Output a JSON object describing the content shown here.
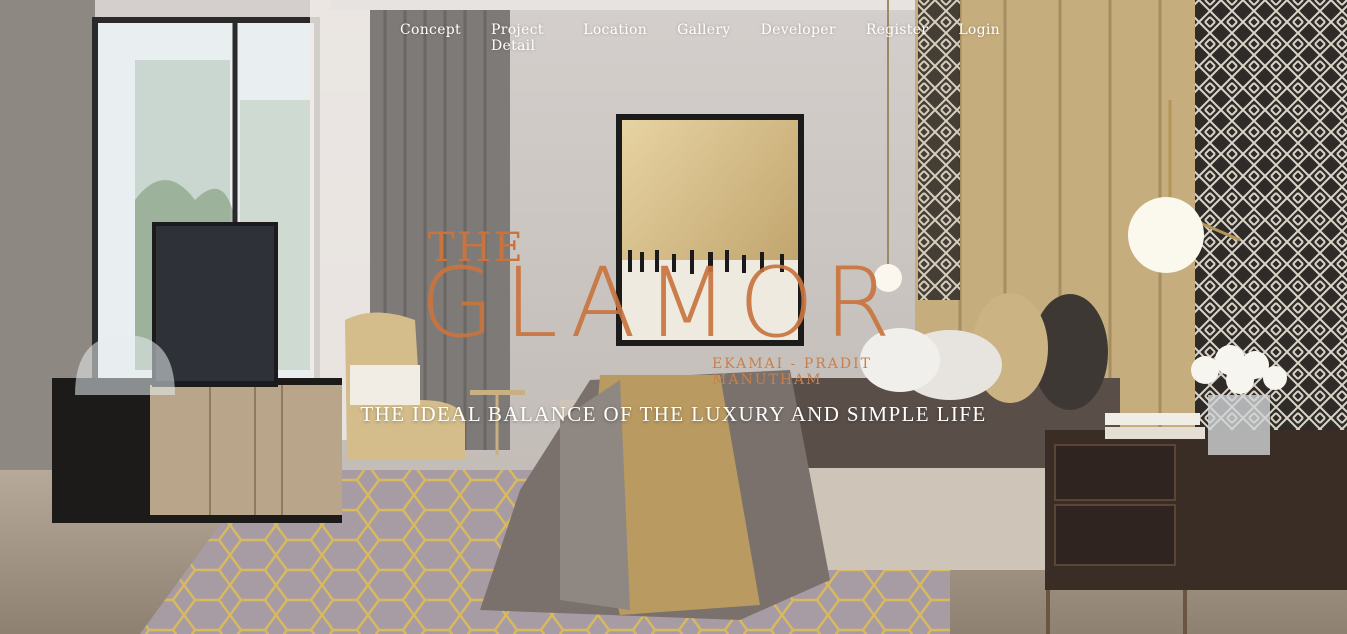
{
  "nav": {
    "items": [
      {
        "label": "Concept"
      },
      {
        "label": "Project Detail"
      },
      {
        "label": "Location"
      },
      {
        "label": "Gallery"
      },
      {
        "label": "Developer"
      },
      {
        "label": "Register"
      },
      {
        "label": "Login"
      }
    ]
  },
  "hero": {
    "logo_the": "THE",
    "logo_name": "GLAMOR",
    "logo_sub": "EKAMAI - PRADIT MANUTHAM",
    "tagline": "THE IDEAL BALANCE OF THE LUXURY AND SIMPLE LIFE"
  },
  "colors": {
    "logo_copper": "#c9743f",
    "nav_text": "#ffffff"
  }
}
